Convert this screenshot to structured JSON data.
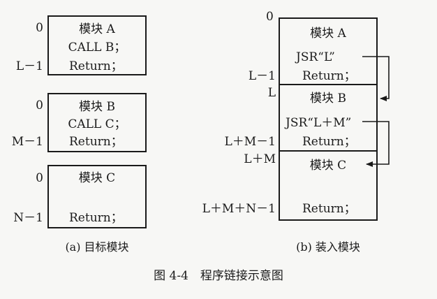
{
  "left": {
    "boxes": [
      {
        "title": "模块 A",
        "line2": "CALL B；",
        "ret": "Return；",
        "start": "0",
        "end": "L－1"
      },
      {
        "title": "模块 B",
        "line2": "CALL C；",
        "ret": "Return；",
        "start": "0",
        "end": "M－1"
      },
      {
        "title": "模块 C",
        "line2": "",
        "ret": "Return；",
        "start": "0",
        "end": "N－1"
      }
    ],
    "caption": "(a) 目标模块"
  },
  "right": {
    "top_label": "0",
    "sections": [
      {
        "title": "模块 A",
        "jsr": "JSR“L”",
        "ret": "Return；",
        "end": "L－1"
      },
      {
        "start": "L",
        "title": "模块 B",
        "jsr": "JSR“L＋M”",
        "ret": "Return；",
        "end": "L＋M－1"
      },
      {
        "start": "L＋M",
        "title": "模块 C",
        "ret": "Return；",
        "end": "L＋M＋N－1"
      }
    ],
    "caption": "(b) 装入模块"
  },
  "figure_caption": "图 4-4　程序链接示意图"
}
